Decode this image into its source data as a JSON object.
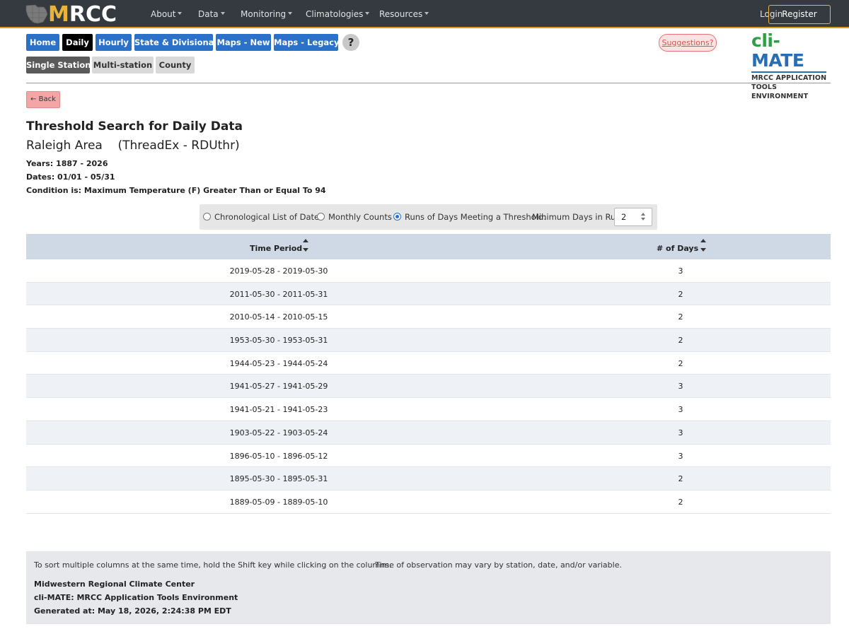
{
  "brand": {
    "logo_text_first": "M",
    "logo_text_rest": "RCC",
    "logo_icon": "midwest-map-icon",
    "accent_color": "#e8b33a"
  },
  "nav": {
    "items": [
      "About",
      "Data",
      "Monitoring",
      "Climatologies",
      "Resources"
    ],
    "login": "Login",
    "register": "Register"
  },
  "tool_tabs": [
    "Home",
    "Daily",
    "Hourly",
    "State & Divisional",
    "Maps - New",
    "Maps - Legacy"
  ],
  "help": "?",
  "suggestions": "Suggestions?",
  "sub_tabs": [
    "Single Station",
    "Multi-station",
    "County"
  ],
  "climate_logo": {
    "prefix": "cli-",
    "name": "MATE",
    "line1": "MRCC APPLICATION",
    "line2": "TOOLS ENVIRONMENT"
  },
  "back_button": "← Back",
  "page": {
    "title": "Threshold Search for Daily Data",
    "station": "Raleigh Area    (ThreadEx - RDUthr)",
    "years": "Years: 1887 - 2026",
    "dates": "Dates: 01/01 - 05/31",
    "condition": "Condition is: Maximum Temperature (F) Greater Than or Equal To 94"
  },
  "options": {
    "chronological": "Chronological List of Dates",
    "monthly": "Monthly Counts",
    "runs": "Runs of Days Meeting a Threshold:",
    "min_days_label": "Minimum Days in Run",
    "min_days_value": "2",
    "selected": "runs"
  },
  "table": {
    "headers": [
      "Time Period",
      "# of Days"
    ],
    "rows": [
      {
        "period": "2019-05-28 - 2019-05-30",
        "days": "3"
      },
      {
        "period": "2011-05-30 - 2011-05-31",
        "days": "2"
      },
      {
        "period": "2010-05-14 - 2010-05-15",
        "days": "2"
      },
      {
        "period": "1953-05-30 - 1953-05-31",
        "days": "2"
      },
      {
        "period": "1944-05-23 - 1944-05-24",
        "days": "2"
      },
      {
        "period": "1941-05-27 - 1941-05-29",
        "days": "3"
      },
      {
        "period": "1941-05-21 - 1941-05-23",
        "days": "3"
      },
      {
        "period": "1903-05-22 - 1903-05-24",
        "days": "3"
      },
      {
        "period": "1896-05-10 - 1896-05-12",
        "days": "3"
      },
      {
        "period": "1895-05-30 - 1895-05-31",
        "days": "2"
      },
      {
        "period": "1889-05-09 - 1889-05-10",
        "days": "2"
      }
    ]
  },
  "footer": {
    "sort_note": "To sort multiple columns at the same time, hold the Shift key while clicking on the columns.",
    "obs_note": "Time of observation may vary by station, date, and/or variable.",
    "org": "Midwestern Regional Climate Center",
    "app": "cli-MATE: MRCC Application Tools Environment",
    "generated": "Generated at: May 18, 2026, 2:24:38 PM EDT"
  }
}
